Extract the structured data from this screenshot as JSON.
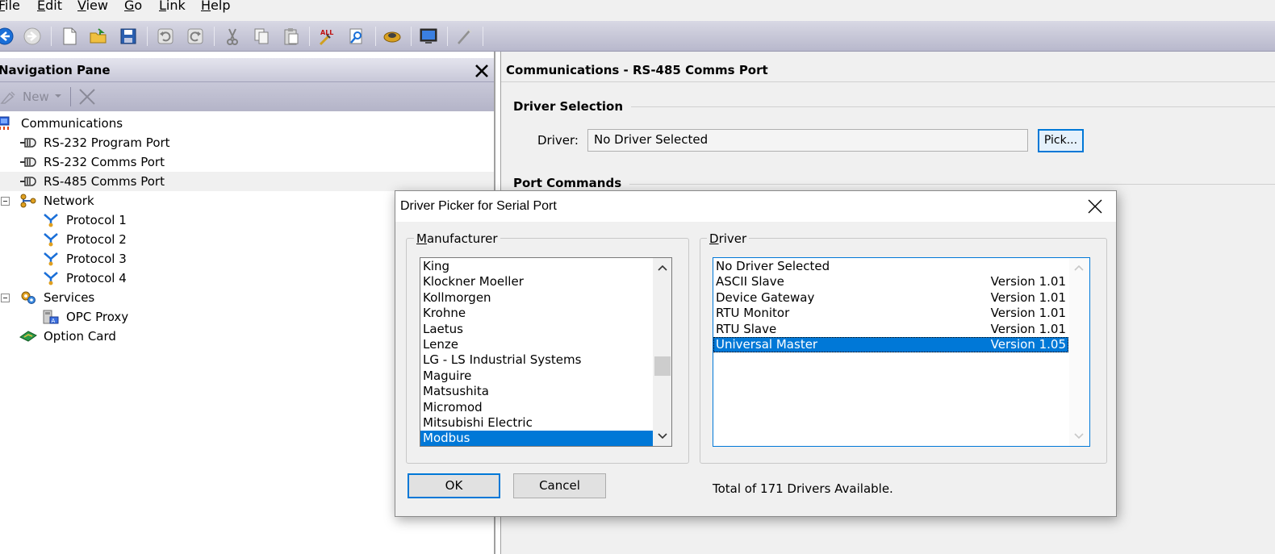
{
  "menu": {
    "items": [
      {
        "id": "file",
        "underline": "F",
        "rest": "ile"
      },
      {
        "id": "edit",
        "underline": "E",
        "rest": "dit"
      },
      {
        "id": "view",
        "underline": "V",
        "rest": "iew"
      },
      {
        "id": "go",
        "underline": "G",
        "rest": "o"
      },
      {
        "id": "link",
        "underline": "L",
        "rest": "ink"
      },
      {
        "id": "help",
        "underline": "H",
        "rest": "elp"
      }
    ]
  },
  "nav": {
    "title": "Navigation Pane",
    "new_label": "New",
    "tree": [
      {
        "label": "Communications",
        "icon": "communications-icon",
        "selected": false
      },
      {
        "label": "RS-232 Program Port",
        "icon": "port-icon",
        "selected": false
      },
      {
        "label": "RS-232 Comms Port",
        "icon": "port-icon",
        "selected": false
      },
      {
        "label": "RS-485 Comms Port",
        "icon": "port-icon",
        "selected": true
      },
      {
        "label": "Network",
        "icon": "network-icon",
        "selected": false
      },
      {
        "label": "Protocol 1",
        "icon": "protocol-icon",
        "selected": false
      },
      {
        "label": "Protocol 2",
        "icon": "protocol-icon",
        "selected": false
      },
      {
        "label": "Protocol 3",
        "icon": "protocol-icon",
        "selected": false
      },
      {
        "label": "Protocol 4",
        "icon": "protocol-icon",
        "selected": false
      },
      {
        "label": "Services",
        "icon": "services-icon",
        "selected": false
      },
      {
        "label": "OPC Proxy",
        "icon": "opc-proxy-icon",
        "selected": false
      },
      {
        "label": "Option Card",
        "icon": "option-card-icon",
        "selected": false
      }
    ]
  },
  "right": {
    "title": "Communications - RS-485 Comms Port",
    "driver_selection": "Driver Selection",
    "driver_label": "Driver:",
    "driver_value": "No Driver Selected",
    "pick_label": "Pick...",
    "port_commands": "Port Commands"
  },
  "dialog": {
    "title": "Driver Picker for Serial Port",
    "manufacturer_legend": {
      "underline": "M",
      "rest": "anufacturer"
    },
    "driver_legend": {
      "underline": "D",
      "rest": "river"
    },
    "manufacturers": [
      "King",
      "Klockner Moeller",
      "Kollmorgen",
      "Krohne",
      "Laetus",
      "Lenze",
      "LG - LS Industrial Systems",
      "Maguire",
      "Matsushita",
      "Micromod",
      "Mitsubishi Electric",
      "Modbus"
    ],
    "selected_manufacturer": "Modbus",
    "drivers": [
      {
        "name": "No Driver Selected",
        "version": ""
      },
      {
        "name": "ASCII Slave",
        "version": "Version 1.01"
      },
      {
        "name": "Device Gateway",
        "version": "Version 1.01"
      },
      {
        "name": "RTU Monitor",
        "version": "Version 1.01"
      },
      {
        "name": "RTU Slave",
        "version": "Version 1.01"
      },
      {
        "name": "Universal Master",
        "version": "Version 1.05"
      }
    ],
    "selected_driver": "Universal Master",
    "ok_label": "OK",
    "cancel_label": "Cancel",
    "total_text": "Total of 171 Drivers Available."
  },
  "colors": {
    "selection": "#0078d7",
    "toolbar_gradient_top": "#d8d8e4",
    "toolbar_gradient_bottom": "#b8b8cc"
  }
}
